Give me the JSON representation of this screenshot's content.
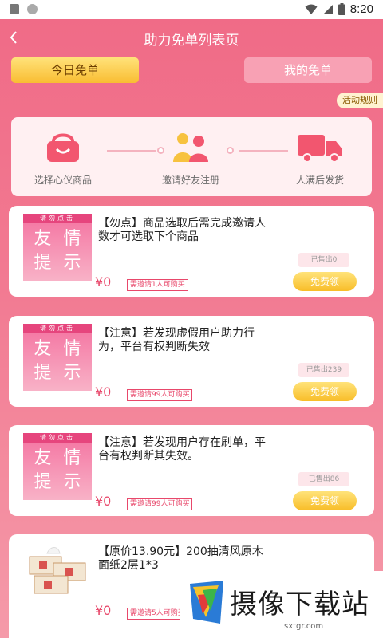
{
  "status_bar": {
    "time": "8:20"
  },
  "header": {
    "title": "助力免单列表页",
    "back_icon": "back-chevron-icon"
  },
  "tabs": [
    {
      "label": "今日免单",
      "active": true
    },
    {
      "label": "我的免单",
      "active": false
    }
  ],
  "rules_label": "活动规则",
  "steps": [
    {
      "label": "选择心仪商品",
      "icon": "shopping-basket-icon"
    },
    {
      "label": "邀请好友注册",
      "icon": "two-people-icon"
    },
    {
      "label": "人满后发货",
      "icon": "delivery-truck-icon"
    }
  ],
  "cards": [
    {
      "thumb_header": "请勿点击",
      "thumb_chars": [
        "友",
        "情",
        "提",
        "示"
      ],
      "title": "【勿点】商品选取后需完成邀请人数才可选取下个商品",
      "price": "¥0",
      "need": "需邀请1人可购买",
      "sold": "已售出0",
      "button": "免费领"
    },
    {
      "thumb_header": "请勿点击",
      "thumb_chars": [
        "友",
        "情",
        "提",
        "示"
      ],
      "title": "【注意】若发现虚假用户助力行为，平台有权判断失效",
      "price": "¥0",
      "need": "需邀请99人可购买",
      "sold": "已售出239",
      "button": "免费领"
    },
    {
      "thumb_header": "请勿点击",
      "thumb_chars": [
        "友",
        "情",
        "提",
        "示"
      ],
      "title": "【注意】若发现用户存在刷单，平台有权判断其失效。",
      "price": "¥0",
      "need": "需邀请99人可购买",
      "sold": "已售出86",
      "button": "免费领"
    },
    {
      "title": "【原价13.90元】200抽清风原木面纸2层1*3",
      "price": "¥0",
      "need": "需邀请5人可购买"
    }
  ],
  "watermark": {
    "text": "摄像下载站",
    "url": "sxtgr.com"
  },
  "colors": {
    "accent": "#e8486b",
    "gold": "#f8bd28",
    "background": "#f06a86"
  }
}
